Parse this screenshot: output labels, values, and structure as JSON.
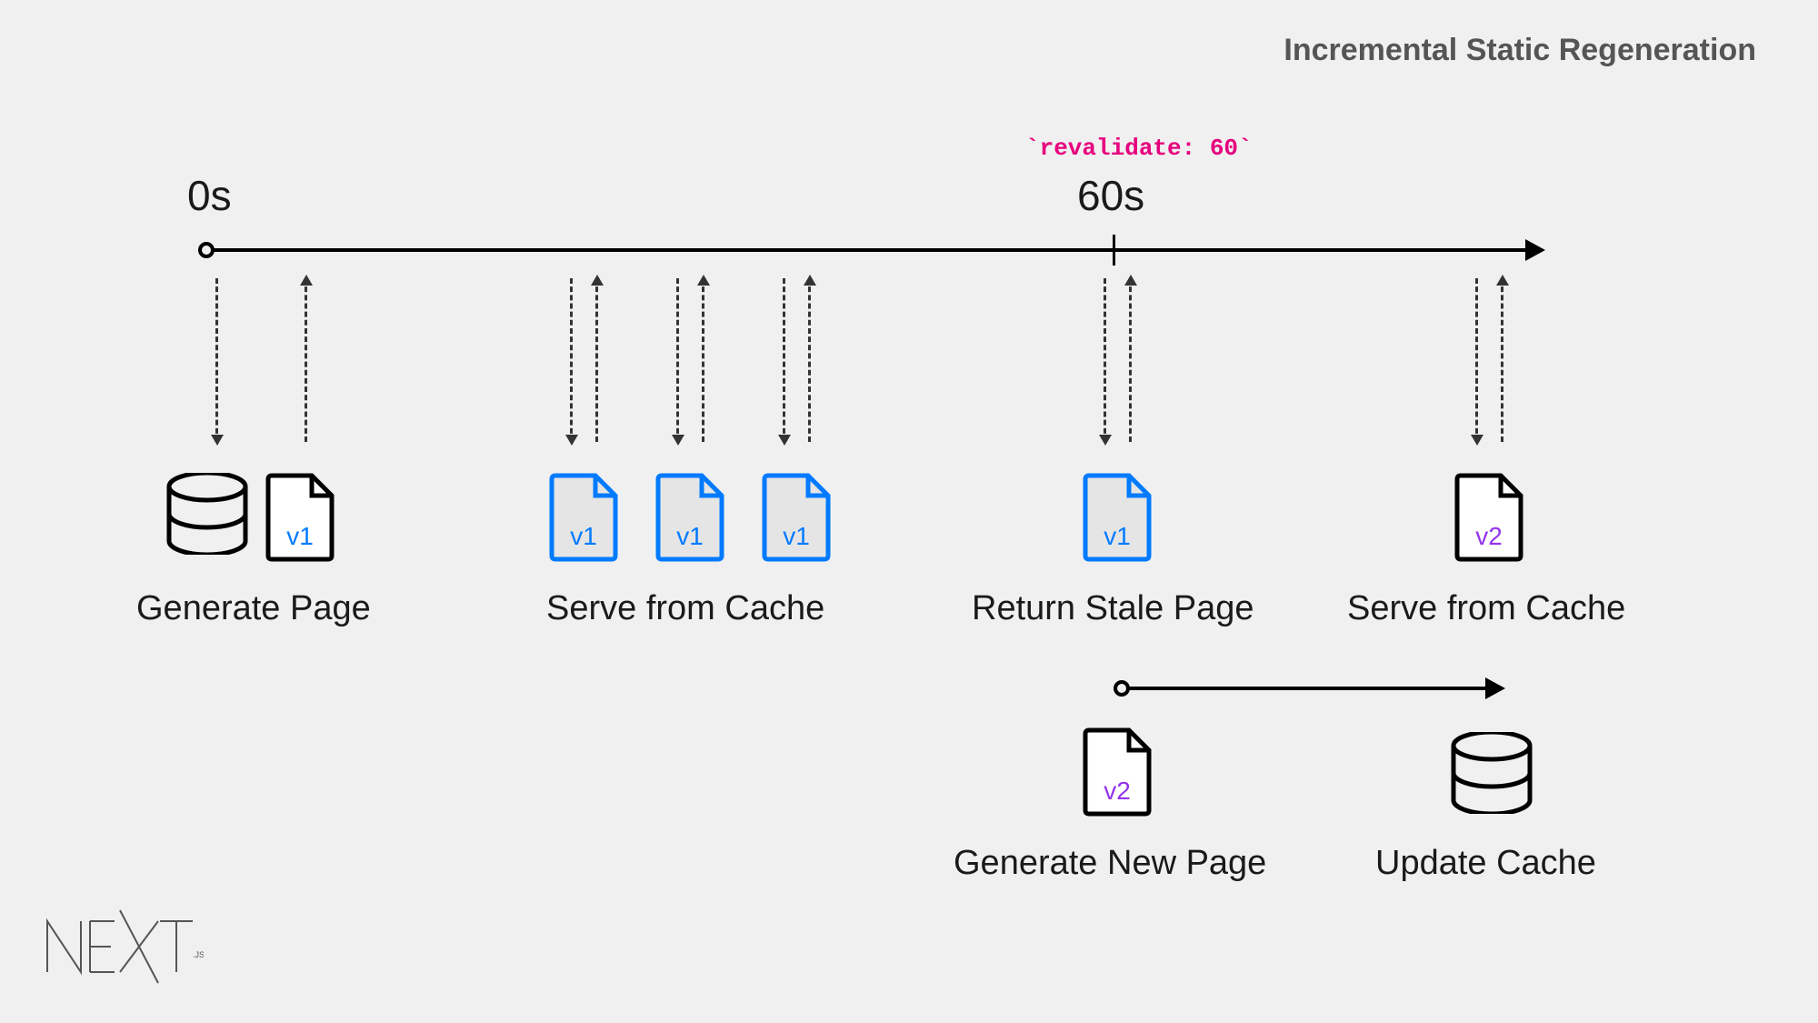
{
  "title": "Incremental Static Regeneration",
  "revalidate_code": "`revalidate: 60`",
  "timeline": {
    "start_label": "0s",
    "mid_label": "60s"
  },
  "sections": {
    "generate": {
      "label": "Generate Page",
      "version": "v1"
    },
    "serve_cache_1": {
      "label": "Serve from Cache",
      "version": "v1"
    },
    "stale": {
      "label": "Return Stale Page",
      "version": "v1"
    },
    "serve_cache_2": {
      "label": "Serve from Cache",
      "version": "v2"
    },
    "generate_new": {
      "label": "Generate New Page",
      "version": "v2"
    },
    "update_cache": {
      "label": "Update Cache"
    }
  },
  "colors": {
    "blue": "#007aff",
    "purple": "#9333ea",
    "pink": "#e6007e"
  },
  "logo": {
    "name": "NEXT",
    "suffix": ".JS"
  }
}
